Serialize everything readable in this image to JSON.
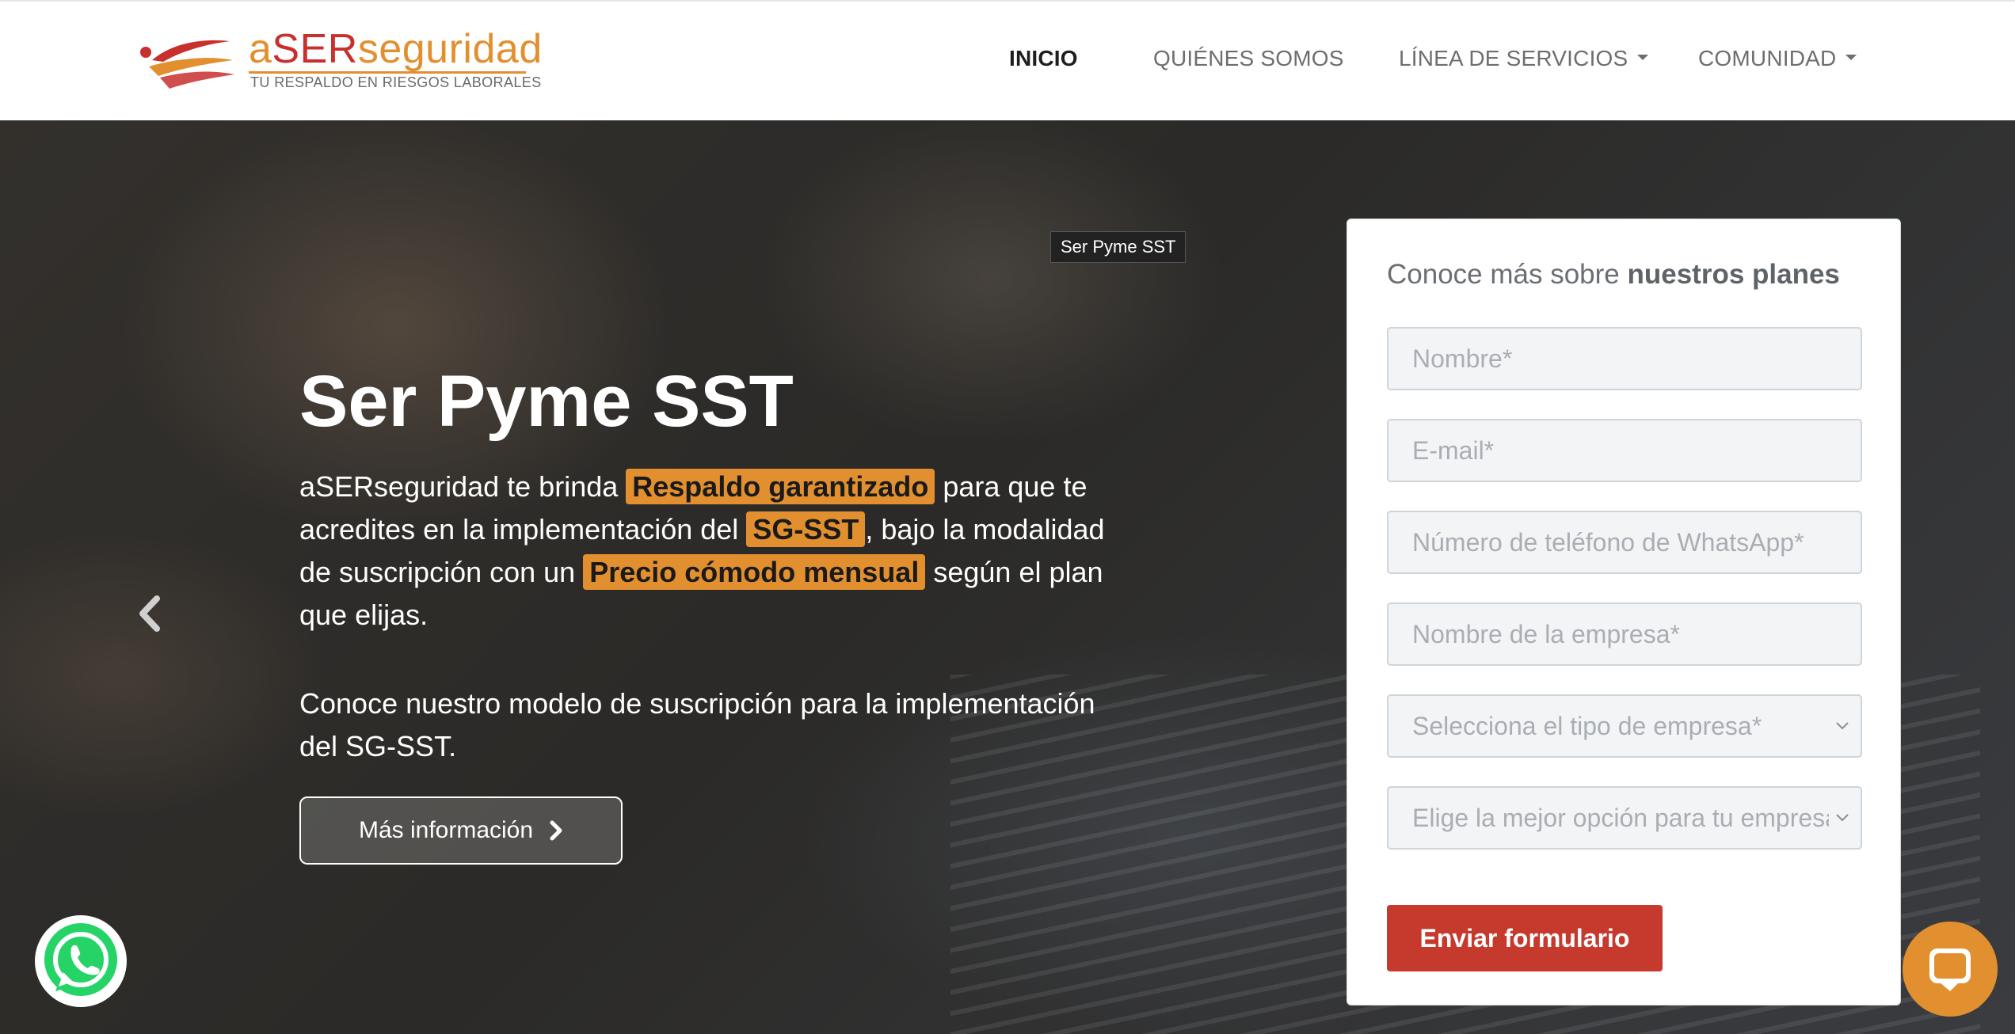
{
  "header": {
    "logo": {
      "prefix": "a",
      "brand_highlight": "SER",
      "brand_suffix": "seguridad",
      "tagline": "TU RESPALDO EN RIESGOS LABORALES"
    },
    "nav": [
      {
        "label": "INICIO",
        "active": true,
        "dropdown": false
      },
      {
        "label": "QUIÉNES SOMOS",
        "active": false,
        "dropdown": false
      },
      {
        "label": "LÍNEA DE SERVICIOS",
        "active": false,
        "dropdown": true
      },
      {
        "label": "COMUNIDAD",
        "active": false,
        "dropdown": true
      }
    ]
  },
  "hero": {
    "tooltip": "Ser Pyme SST",
    "title": "Ser Pyme SST",
    "paragraph": {
      "t1": "aSERseguridad te brinda ",
      "h1": "Respaldo garantizado",
      "t2": " para que te acredites en la implementación del ",
      "h2": "SG-SST",
      "t3": ", bajo la modalidad de suscripción con un ",
      "h3": "Precio cómodo mensual",
      "t4": " según el plan que elijas."
    },
    "paragraph2": "Conoce nuestro modelo de suscripción para la implementación del SG-SST.",
    "button_label": "Más información"
  },
  "form": {
    "title_plain": "Conoce más sobre ",
    "title_bold": "nuestros planes",
    "fields": {
      "name": "Nombre*",
      "email": "E-mail*",
      "phone": "Número de teléfono de WhatsApp*",
      "company": "Nombre de la empresa*",
      "company_type": "Selecciona el tipo de empresa*",
      "best_option": "Elige la mejor opción para tu empresa"
    },
    "submit_label": "Enviar formulario"
  },
  "colors": {
    "accent_orange": "#e2902f",
    "brand_red": "#c8302e",
    "submit_red": "#c53a2d",
    "whatsapp_green": "#25d366"
  },
  "icons": {
    "prev": "chevron-left-icon",
    "button": "chevron-right-icon",
    "whatsapp": "whatsapp-icon",
    "chat": "chat-icon",
    "logo": "swoosh-logo-icon"
  }
}
